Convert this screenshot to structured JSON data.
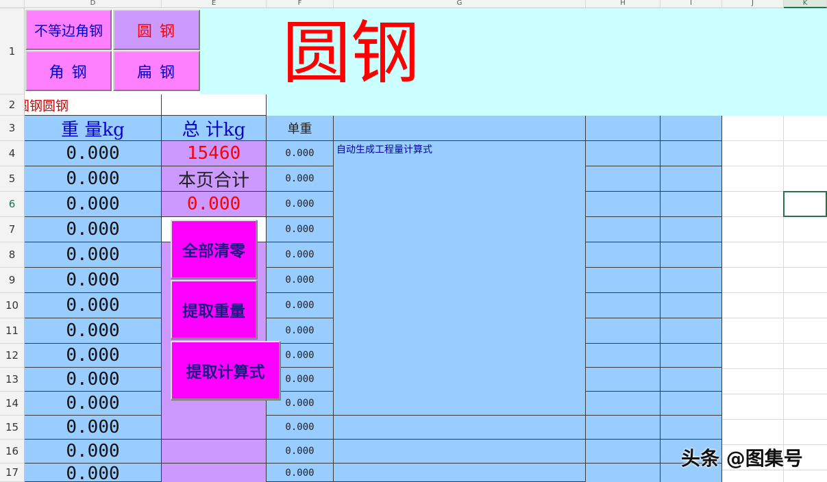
{
  "columns": [
    "D",
    "E",
    "F",
    "G",
    "H",
    "I",
    "J",
    "K"
  ],
  "rows": [
    "1",
    "2",
    "3",
    "4",
    "5",
    "6",
    "7",
    "8",
    "9",
    "10",
    "11",
    "12",
    "13",
    "14",
    "15",
    "16",
    "17"
  ],
  "nav_buttons": {
    "unequal_angle": "不等边角钢",
    "round_steel": "圆 钢",
    "angle_steel": "角 钢",
    "flat_steel": "扁 钢"
  },
  "sheet_title": "圆钢",
  "row2_label": "圆钢圆钢",
  "headers": {
    "weight": "重 量kg",
    "total": "总 计kg",
    "unit_weight": "单重"
  },
  "formula_hint": "自动生成工程量计算式",
  "total_value": "15460",
  "page_total_label": "本页合计",
  "page_total_value": "0.000",
  "weights": [
    "0.000",
    "0.000",
    "0.000",
    "0.000",
    "0.000",
    "0.000",
    "0.000",
    "0.000",
    "0.000",
    "0.000",
    "0.000",
    "0.000",
    "0.000",
    "0.000"
  ],
  "unit_weights": [
    "0.000",
    "0.000",
    "0.000",
    "0.000",
    "0.000",
    "0.000",
    "0.000",
    "0.000",
    "0.000",
    "0.000",
    "0.000",
    "0.000",
    "0.000",
    "0.000"
  ],
  "macro_buttons": {
    "clear_all": "全部清零",
    "extract_weight": "提取重量",
    "extract_formula": "提取计算式"
  },
  "watermark": "头条 @图集号",
  "colors": {
    "cyan_header": "#ccffff",
    "cell_blue": "#99ccff",
    "cell_purple": "#cc99ff",
    "nav_pink": "#ff80ff",
    "macro_magenta": "#ff00ff",
    "title_red": "#ff0000",
    "selection_green": "#217346"
  }
}
